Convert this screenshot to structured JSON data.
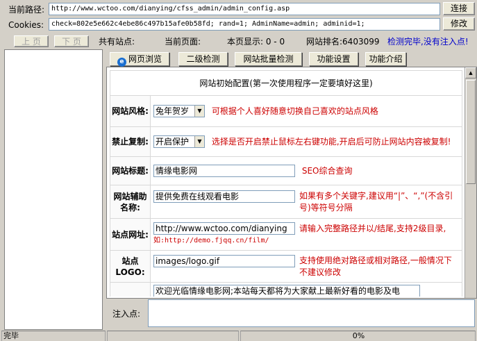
{
  "toolbar": {
    "path_label": "当前路径:",
    "path_value": "http://www.wctoo.com/dianying/cfss_admin/admin_config.asp",
    "connect_label": "连接",
    "cookies_label": "Cookies:",
    "cookies_value": "check=802e5e662c4ebe86c497b15afe0b58fd; rand=1; AdminName=admin; adminid=1;",
    "modify_label": "修改"
  },
  "infobar": {
    "prev_label": "上 页",
    "next_label": "下 页",
    "total_sites": "共有站点:",
    "current_page": "当前页面:",
    "page_display": "本页显示: 0 - 0",
    "rank": "网站排名:6403099",
    "status": "检测完毕,没有注入点!"
  },
  "tabs": [
    {
      "label": "网页浏览"
    },
    {
      "label": "二级检测"
    },
    {
      "label": "网站批量检测"
    },
    {
      "label": "功能设置"
    },
    {
      "label": "功能介绍"
    }
  ],
  "form": {
    "header": "网站初始配置(第一次使用程序一定要填好这里)",
    "rows": {
      "style": {
        "label": "网站风格:",
        "value": "兔年贺岁",
        "note": "可根据个人喜好随意切换自己喜欢的站点风格"
      },
      "copy": {
        "label": "禁止复制:",
        "value": "开启保护",
        "note": "选择是否开启禁止鼠标左右键功能,开启后可防止网站内容被复制!"
      },
      "title": {
        "label": "网站标题:",
        "value": "情缘电影网",
        "note": "SEO综合查询"
      },
      "sub": {
        "label": "网站辅助名称:",
        "value": "提供免费在线观看电影",
        "note": "如果有多个关键字,建议用“|”、“,”(不含引号)等符号分隔"
      },
      "url": {
        "label": "站点网址:",
        "value": "http://www.wctoo.com/dianying",
        "note": "请输入完整路径并以/结尾,支持2级目录,",
        "example": "如:http://demo.fjqq.cn/film/"
      },
      "logo": {
        "label": "站点LOGO:",
        "value": "images/logo.gif",
        "note": "支持使用绝对路径或相对路径,一般情况下不建议修改"
      },
      "desc": {
        "value": "欢迎光临情缘电影网;本站每天都将为大家献上最新好看的电影及电"
      }
    }
  },
  "inject": {
    "label": "注入点:",
    "value": ""
  },
  "statusbar": {
    "left": "完毕",
    "progress": "0%"
  }
}
